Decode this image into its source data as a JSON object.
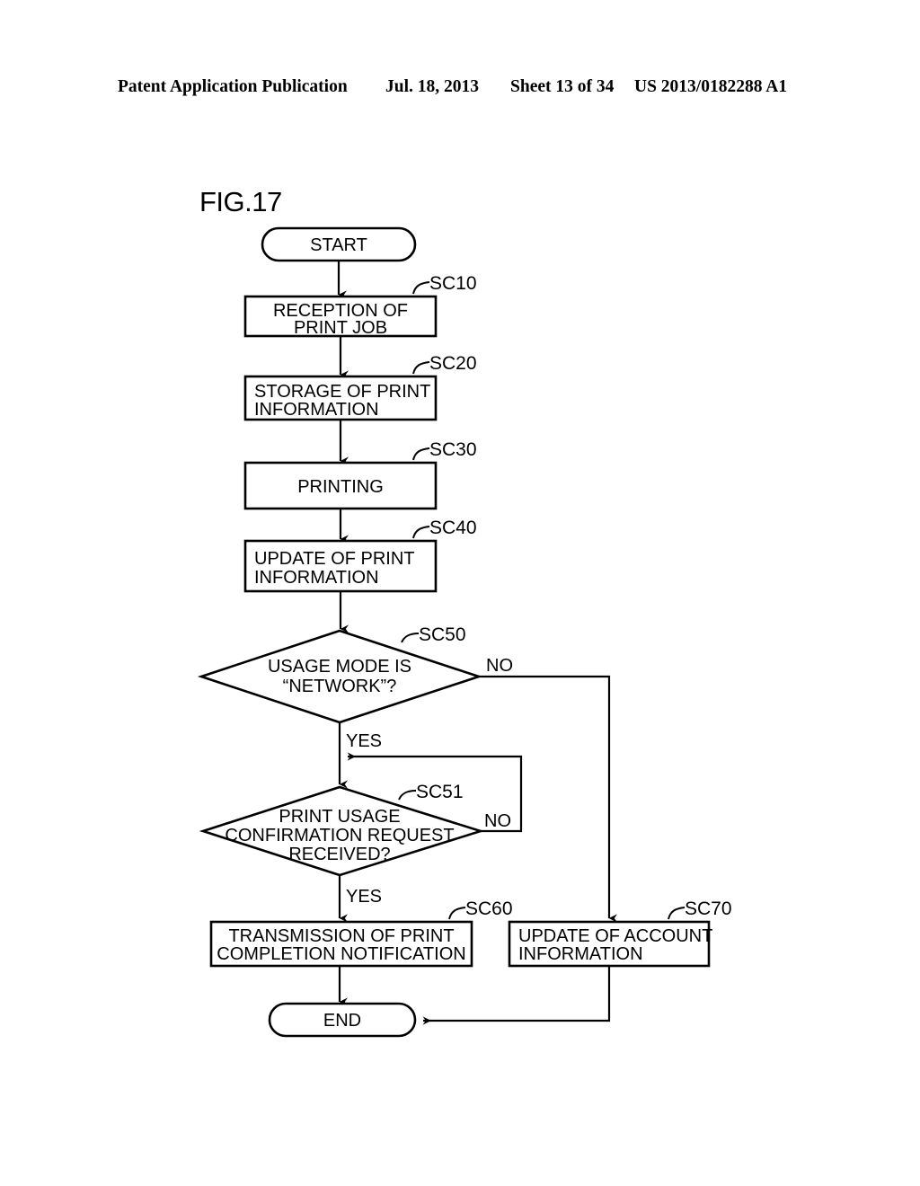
{
  "header": {
    "publication": "Patent Application Publication",
    "date": "Jul. 18, 2013",
    "sheet": "Sheet 13 of 34",
    "patent_number": "US 2013/0182288 A1"
  },
  "figure": {
    "label": "FIG.17"
  },
  "flowchart": {
    "start": {
      "label": "START"
    },
    "end": {
      "label": "END"
    },
    "steps": [
      {
        "ref": "SC10",
        "line1": "RECEPTION OF",
        "line2": "PRINT JOB"
      },
      {
        "ref": "SC20",
        "line1": "STORAGE OF PRINT",
        "line2": "INFORMATION"
      },
      {
        "ref": "SC30",
        "line1": "PRINTING",
        "line2": ""
      },
      {
        "ref": "SC40",
        "line1": "UPDATE OF PRINT",
        "line2": "INFORMATION"
      },
      {
        "ref": "SC60",
        "line1": "TRANSMISSION OF PRINT",
        "line2": "COMPLETION NOTIFICATION"
      },
      {
        "ref": "SC70",
        "line1": "UPDATE OF ACCOUNT",
        "line2": "INFORMATION"
      }
    ],
    "decisions": [
      {
        "ref": "SC50",
        "line1": "USAGE MODE IS",
        "line2": "“NETWORK”?",
        "line3": "",
        "yes": "YES",
        "no": "NO"
      },
      {
        "ref": "SC51",
        "line1": "PRINT USAGE",
        "line2": "CONFIRMATION REQUEST",
        "line3": "RECEIVED?",
        "yes": "YES",
        "no": "NO"
      }
    ]
  }
}
